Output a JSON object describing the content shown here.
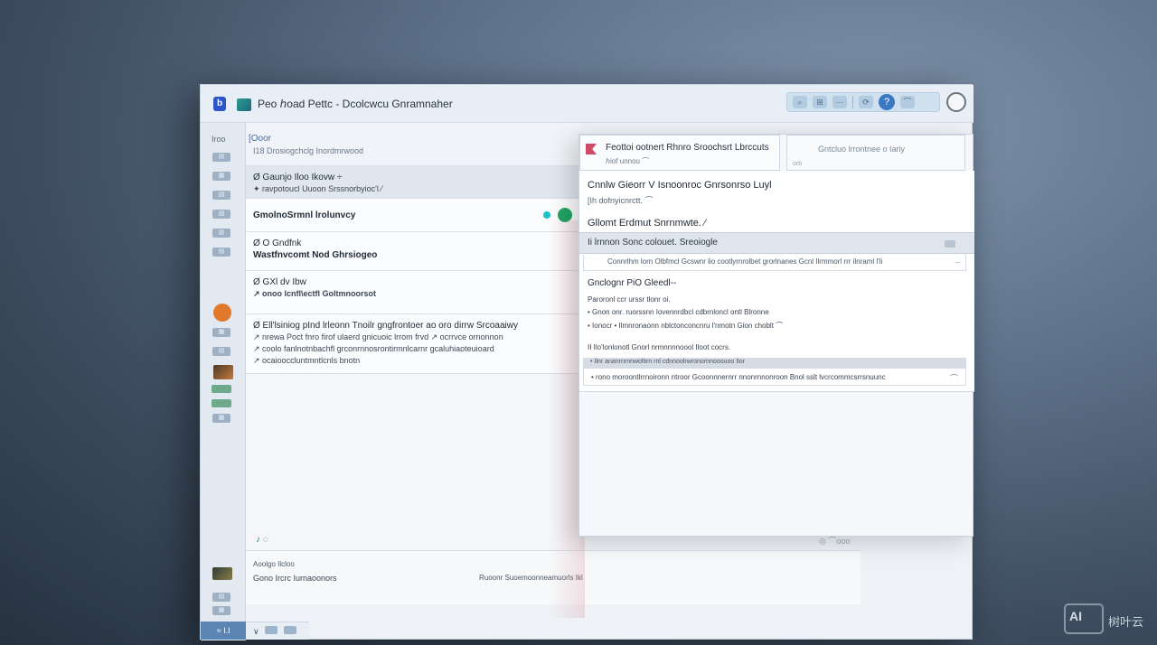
{
  "titlebar": {
    "logo": "b",
    "title": "Peo  ℎoad Pettc  - Dcolcwcu Gnramnaher"
  },
  "toolbar": {
    "btn1": "⌕",
    "btn2": "⊞",
    "btn3": "⋯",
    "btn4": "⟳",
    "help": "?",
    "btn5": "⌒"
  },
  "sidebar": {
    "top_label": "Iroo",
    "items": [
      "▤",
      "▦",
      "▤",
      "▧",
      "▥",
      "▤",
      "▦",
      "▤",
      "▦",
      "▤"
    ],
    "footer": "≈  I.l"
  },
  "list": {
    "header_tag": "[Ooor",
    "header_sub": "I18  Drosiogchclg  Inordmrwood",
    "items": [
      {
        "l1": "Ø  Gaunjo Iloo Ikovw ÷",
        "l2": "✦  ravpotoucl Uuoon Srssnorbyioc'l ⁄"
      },
      {
        "l1": "GmolnoSrmnl lrolunvcy",
        "l2": ""
      },
      {
        "l1": "Ø  O  Gndfnk",
        "l2": "Wastfnvcomt  Nod Ghrsiogeo"
      },
      {
        "l1": "Ø  GXl dv Ibw",
        "l2": "↗  onoo lcnfl\\ectfl Goltmnoorsot"
      },
      {
        "l1": "Ø  Ell'lsiniog pInd lrleonn Tnoilr gngfrontoer ao oro dirrw Srcoaaiwy",
        "l2": "↗  nrewa Poct fnro firof ulaerd  gnicuoic lrrom frvd ↗ ocrrvce  ornonnon",
        "l3": "↗  coolo fanlnotnbachfl grconrnnosrontirmnlcarnr  gcaluhiaoteuioard",
        "l4": "↗  ocaiooccluntmntlcnls bnotn"
      }
    ]
  },
  "bottom": {
    "l1": "Aoolgo Ilcloo",
    "l2": "Gono  Ircrc Iurnaoonors",
    "mid": "Ruoonr Suoemoonneamuorls  Ikl",
    "right": "◎  ⌒ooo",
    "icon": "♪ ◌"
  },
  "reading": {
    "tab1_title": "Feottoi ootnert  Rhnro  Sroochsrt Lbrccuts",
    "tab1_sub": "ℎiof  unnou  ⌒",
    "tab2_title": "Gntcluo        lrrontnee o Iariy",
    "tab2_hint": "orb",
    "h1": "Cnnlw Gieorr V Isnoonroc Gnrsonrso Luyl",
    "h1_sub": "[Ih dofnyicnrctt. ⌒",
    "h2": "Gllomt Erdmut  Snrnmwte.  ⁄",
    "bar": "Ii lrnnon  Sonc colouet.  Sreoiogle",
    "row": "Connrlhm lorn  Olbfmcl Gcswnr  lio  cootlyrnrolbet grorlnanes  Gcnl Ilrmmorl  rrr ilnraml  l'li",
    "h3": "Gnclognr PiO Gleedl--",
    "p1": "Paroronl ccr  urssr  tlonr oi.",
    "b1": "•  Gnon  onr.  ruorssnn  Iovennrdbcl  cdbrnloncl ontl Blronne",
    "b2": "•  Ionocr  •  Ilmnronaonn nblctonconcnru l'nmotn Gion choblt ⌒",
    "p2": "II  Ilo'lonlonotl  Gnorl  nrmnnnnoool Iloot cocrs.",
    "strip": "• Ilnr  ananrnrnnwoltirn rnl cdnnoolrwronornnooouoo Ilor",
    "strip2": "•  rono  moroontlrrnoironn  ntroor  Gcoonnnernrr nnonrnnonroon  Bnol  sslt  lvcrcommcsrrsnuunc",
    "strip2_x": "⌒"
  },
  "watermark": {
    "logo": "AI",
    "text": "树叶云"
  },
  "colors": {
    "accent": "#3b78c4",
    "unread_dot": "#1ec1c8",
    "online_dot": "#23a263",
    "flag": "#d14a68"
  }
}
